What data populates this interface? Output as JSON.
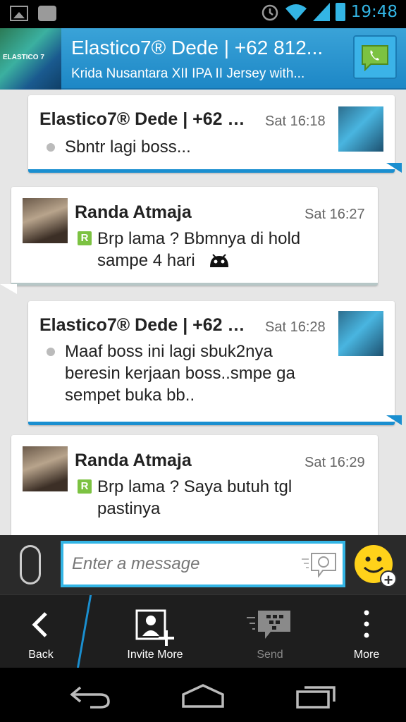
{
  "status_bar": {
    "time": "19:48"
  },
  "header": {
    "title": "Elastico7® Dede | +62 812...",
    "subtitle": "Krida Nusantara XII IPA II Jersey with...",
    "avatar_text": "ELASTICO 7"
  },
  "messages": [
    {
      "sender": "Elastico7® Dede | +62 8...",
      "time": "Sat 16:18",
      "text": "Sbntr lagi boss...",
      "direction": "out"
    },
    {
      "sender": "Randa Atmaja",
      "time": "Sat 16:27",
      "text": "Brp lama ? Bbmnya di hold",
      "text2": "sampe 4 hari",
      "badge": "R",
      "direction": "in"
    },
    {
      "sender": "Elastico7® Dede | +62 8...",
      "time": "Sat 16:28",
      "text": "Maaf boss ini lagi sbuk2nya",
      "text2": "beresin kerjaan boss..smpe ga",
      "text3": "sempet buka bb..",
      "direction": "out"
    },
    {
      "sender": "Randa Atmaja",
      "time": "Sat 16:29",
      "text": "Brp lama ? Saya butuh tgl",
      "text2": "pastinya",
      "badge": "R",
      "direction": "in"
    }
  ],
  "input": {
    "placeholder": "Enter a message"
  },
  "actions": {
    "back": "Back",
    "invite": "Invite More",
    "send": "Send",
    "more": "More"
  },
  "colors": {
    "accent": "#33b5e5",
    "header": "#1d87c6",
    "badge": "#7cc242"
  }
}
